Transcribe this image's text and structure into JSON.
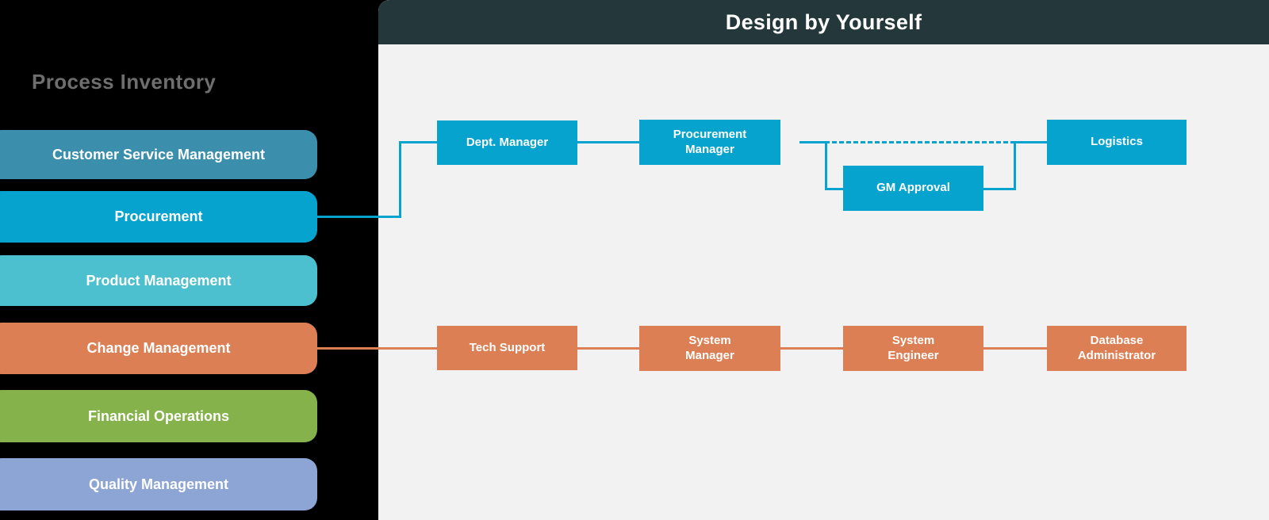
{
  "colors": {
    "page_background": "#000000",
    "canvas_background": "#f2f2f2",
    "header_background": "#24383b",
    "blue_accent": "#06a3ce",
    "orange_accent": "#dd7f54"
  },
  "sidebar": {
    "title": "Process Inventory",
    "items": [
      {
        "label": "Customer Service Management",
        "color": "#3b8fad"
      },
      {
        "label": "Procurement",
        "color": "#06a3ce"
      },
      {
        "label": "Product Management",
        "color": "#4cc0ce"
      },
      {
        "label": "Change Management",
        "color": "#dd7f54"
      },
      {
        "label": "Financial Operations",
        "color": "#86b24b"
      },
      {
        "label": "Quality Management",
        "color": "#8da5d4"
      }
    ]
  },
  "canvas": {
    "title": "Design by Yourself",
    "flows": [
      {
        "name": "procurement-flow",
        "color": "#06a3ce",
        "nodes": [
          {
            "label": "Dept. Manager"
          },
          {
            "label": "Procurement Manager"
          },
          {
            "label": "GM Approval"
          },
          {
            "label": "Logistics"
          }
        ]
      },
      {
        "name": "change-management-flow",
        "color": "#dd7f54",
        "nodes": [
          {
            "label": "Tech Support"
          },
          {
            "label": "System Manager"
          },
          {
            "label": "System Engineer"
          },
          {
            "label": "Database Administrator"
          }
        ]
      }
    ]
  }
}
